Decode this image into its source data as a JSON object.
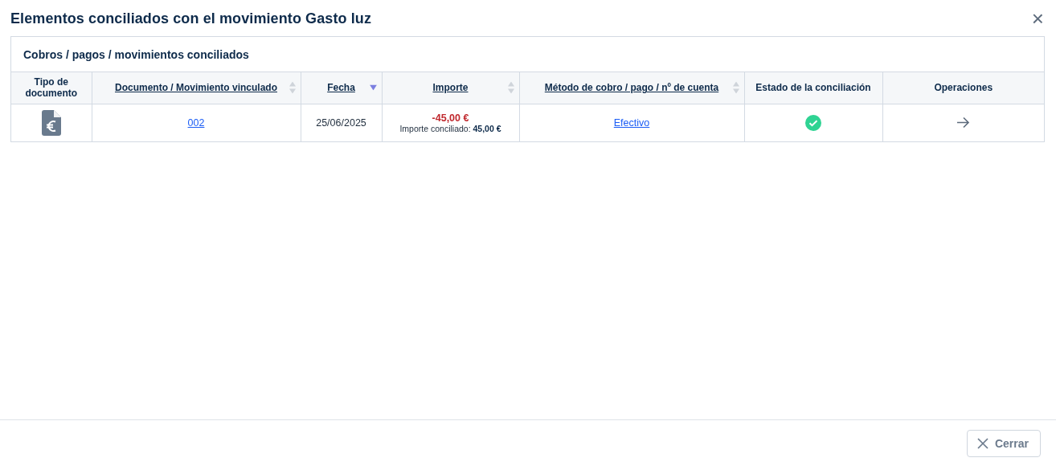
{
  "dialog": {
    "title": "Elementos conciliados con el movimiento Gasto luz",
    "close_label": "×"
  },
  "section": {
    "title": "Cobros / pagos / movimientos conciliados"
  },
  "table": {
    "columns": [
      {
        "label": "Tipo de documento",
        "sortable": false
      },
      {
        "label": "Documento / Movimiento vinculado",
        "sortable": true,
        "sorted": false
      },
      {
        "label": "Fecha",
        "sortable": true,
        "sorted": true
      },
      {
        "label": "Importe",
        "sortable": true,
        "sorted": false
      },
      {
        "label": "Método de cobro / pago / nº de cuenta",
        "sortable": true,
        "sorted": false
      },
      {
        "label": "Estado de la conciliación",
        "sortable": false
      },
      {
        "label": "Operaciones",
        "sortable": false
      }
    ],
    "rows": [
      {
        "kind": "payment",
        "document": "002",
        "date": "25/06/2025",
        "amount": "-45,00 €",
        "negative": true,
        "reconciled_amount": "Importe conciliado: **45,00 €**",
        "method": "Efectivo",
        "reconciled": true
      }
    ]
  },
  "footer": {
    "buttons": [
      {
        "label": "Cerrar"
      }
    ]
  }
}
